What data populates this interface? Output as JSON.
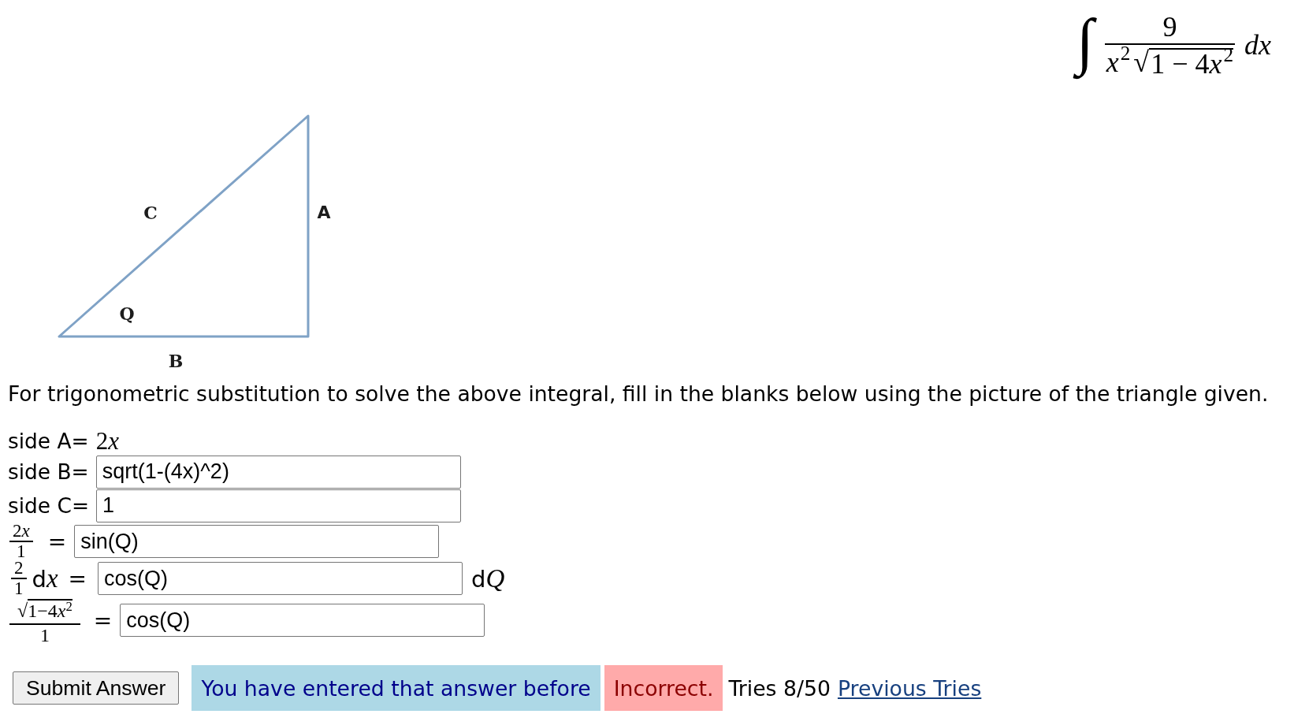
{
  "integral": {
    "sign": "∫",
    "numerator": [
      {
        "kind": "text",
        "text": "9"
      }
    ],
    "denominator": [
      {
        "kind": "var",
        "text": "x$^{2}$"
      }
    ],
    "radical": "√",
    "radicand": [
      {
        "kind": "text",
        "text": "1 − 4"
      },
      {
        "kind": "var",
        "text": "x$^{2}$"
      }
    ],
    "differential": [
      {
        "kind": "var",
        "text": "dx"
      }
    ]
  },
  "triangle": {
    "labels": [
      {
        "kind": "hypotenuse",
        "text": "C"
      },
      {
        "kind": "opposite",
        "text": "A"
      },
      {
        "kind": "angle",
        "text": "Q"
      },
      {
        "kind": "adjacent",
        "text": "B"
      }
    ]
  },
  "instructions": "For trigonometric substitution to solve the above integral, fill in the blanks below using the picture of the triangle given.",
  "rows": [
    {
      "kind": "given",
      "label": "side A=",
      "value": [
        {
          "kind": "text",
          "text": "2"
        },
        {
          "kind": "var",
          "text": "x"
        }
      ]
    },
    {
      "kind": "input",
      "label": "side B=",
      "value": "sqrt(1-(4x)^2)"
    },
    {
      "kind": "input",
      "label": "side C=",
      "value": "1"
    },
    {
      "kind": "fraction_input",
      "numerator": [
        {
          "kind": "text",
          "text": "2"
        },
        {
          "kind": "var",
          "text": "x"
        }
      ],
      "denominator": [
        {
          "kind": "text",
          "text": "1"
        }
      ],
      "relation": "=",
      "value": "sin(Q)"
    },
    {
      "kind": "differential_input",
      "numerator": [
        {
          "kind": "text",
          "text": "2"
        }
      ],
      "denominator": [
        {
          "kind": "text",
          "text": "1"
        }
      ],
      "differential": [
        {
          "kind": "text",
          "text": "d"
        },
        {
          "kind": "var",
          "text": "x"
        }
      ],
      "relation": "=",
      "value": "cos(Q)",
      "suffix": [
        {
          "kind": "text",
          "text": "d"
        },
        {
          "kind": "var",
          "text": "Q"
        }
      ]
    },
    {
      "kind": "radical_fraction_input",
      "radical": "√",
      "radicand": [
        {
          "kind": "text",
          "text": "1−4"
        },
        {
          "kind": "var",
          "text": "x$^{2}$"
        }
      ],
      "denominator": [
        {
          "kind": "text",
          "text": "1"
        }
      ],
      "relation": "=",
      "value": "cos(Q)"
    }
  ],
  "submit_button": "Submit Answer",
  "feedback": [
    {
      "kind": "notice",
      "text": "You have entered that answer before"
    },
    {
      "kind": "incorrect",
      "text": "Incorrect."
    }
  ],
  "tries": "Tries 8/50",
  "previous_tries_link": "Previous Tries"
}
